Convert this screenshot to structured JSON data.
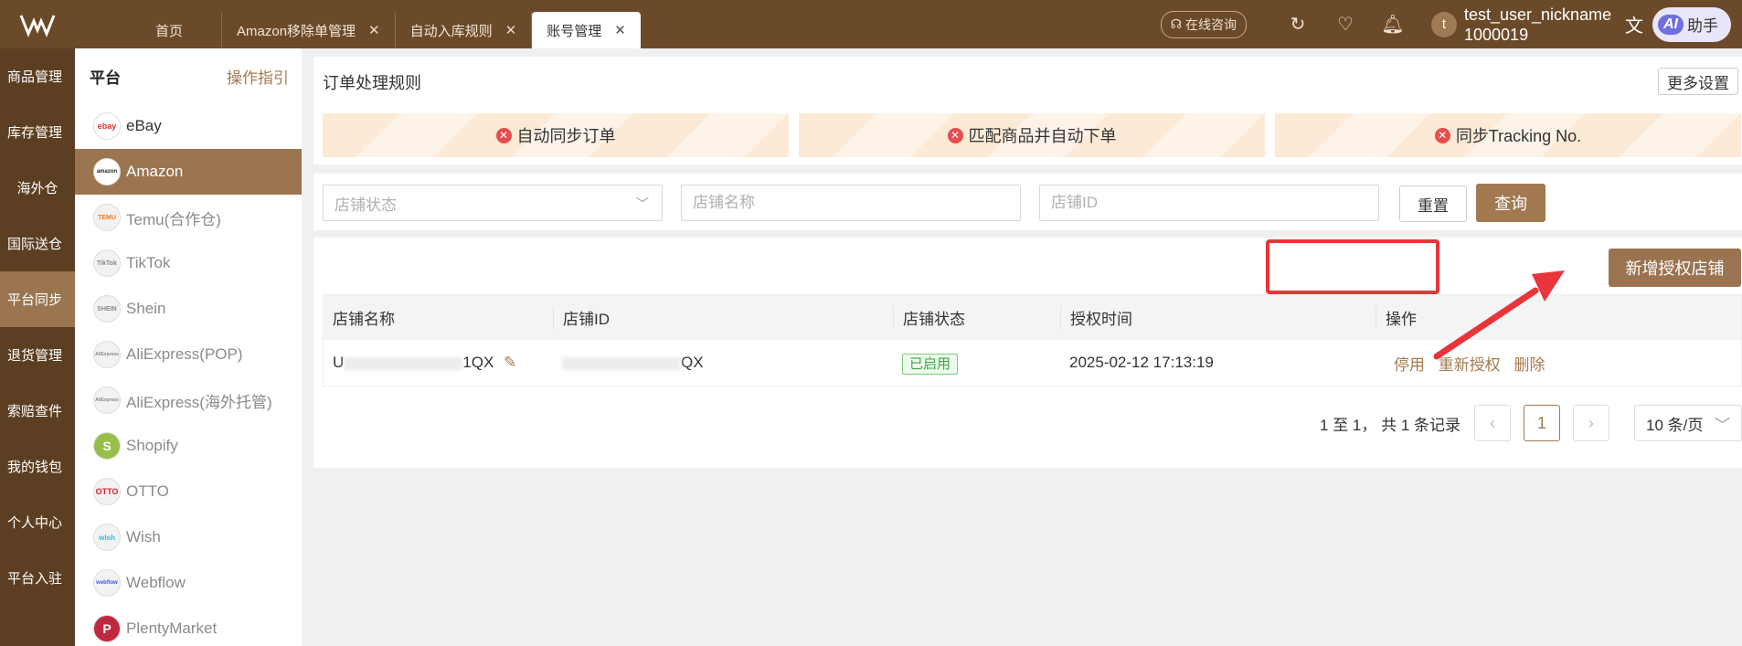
{
  "topbar": {
    "tabs": [
      {
        "label": "首页",
        "closable": false
      },
      {
        "label": "Amazon移除单管理",
        "closable": true
      },
      {
        "label": "自动入库规则",
        "closable": true
      },
      {
        "label": "账号管理",
        "closable": true,
        "active": true
      }
    ],
    "consult_label": "在线咨询",
    "user_line1": "test_user_nickname",
    "user_line2": "1000019",
    "avatar_letter": "t",
    "ai_badge": "AI",
    "ai_label": "助手"
  },
  "leftnav": {
    "items": [
      "商品管理",
      "库存管理",
      "海外仓",
      "国际送仓",
      "平台同步",
      "退货管理",
      "索赔查件",
      "我的钱包",
      "个人中心",
      "平台入驻"
    ],
    "active_index": 4
  },
  "platforms": {
    "title": "平台",
    "guide": "操作指引",
    "items": [
      {
        "label": "eBay",
        "logo": "ebay"
      },
      {
        "label": "Amazon",
        "logo": "amazon"
      },
      {
        "label": "Temu(合作仓)",
        "logo": "TEMU"
      },
      {
        "label": "TikTok",
        "logo": "TikTok"
      },
      {
        "label": "Shein",
        "logo": "SHEIN"
      },
      {
        "label": "AliExpress(POP)",
        "logo": "AliExpress"
      },
      {
        "label": "AliExpress(海外托管)",
        "logo": "AliExpress"
      },
      {
        "label": "Shopify",
        "logo": "S"
      },
      {
        "label": "OTTO",
        "logo": "OTTO"
      },
      {
        "label": "Wish",
        "logo": "wish"
      },
      {
        "label": "Webflow",
        "logo": "webflow"
      },
      {
        "label": "PlentyMarket",
        "logo": "P"
      }
    ],
    "active_index": 1
  },
  "rules": {
    "title": "订单处理规则",
    "more_settings": "更多设置",
    "items": [
      "自动同步订单",
      "匹配商品并自动下单",
      "同步Tracking No."
    ]
  },
  "filters": {
    "status_placeholder": "店铺状态",
    "name_placeholder": "店铺名称",
    "id_placeholder": "店铺ID",
    "reset": "重置",
    "query": "查询"
  },
  "table": {
    "new_button": "新增授权店铺",
    "headers": [
      "店铺名称",
      "店铺ID",
      "店铺状态",
      "授权时间",
      "操作"
    ],
    "rows": [
      {
        "name_prefix": "U",
        "name_suffix": "1QX",
        "id_suffix": "QX",
        "status": "已启用",
        "auth_time": "2025-02-12 17:13:19",
        "actions": [
          "停用",
          "重新授权",
          "删除"
        ]
      }
    ]
  },
  "pager": {
    "summary": "1 至 1， 共 1 条记录",
    "current_page": "1",
    "page_size": "10 条/页"
  },
  "colors": {
    "brand_dark": "#6b4a2a",
    "brand": "#a27950",
    "annotation_red": "#e8343a"
  }
}
